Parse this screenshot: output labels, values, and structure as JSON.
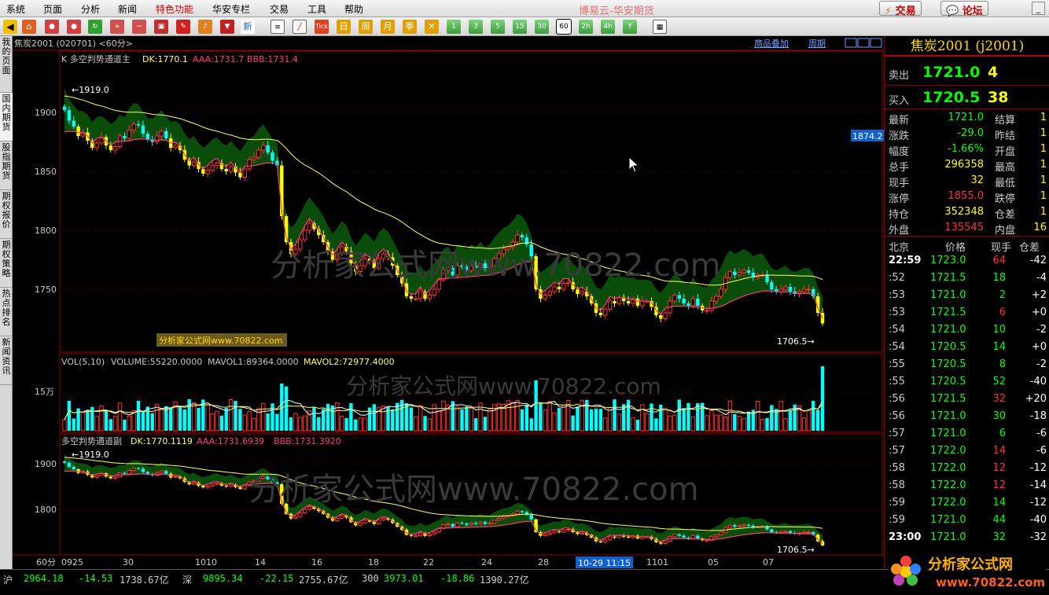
{
  "menu": {
    "items": [
      "系统",
      "页面",
      "分析",
      "新闻",
      "特色功能",
      "华安专栏",
      "交易",
      "工具",
      "帮助"
    ],
    "title": "博易云-华安期货",
    "trade_button": "交易",
    "forum_button": "论坛"
  },
  "toolbar": {
    "periods": [
      "1",
      "3",
      "5",
      "15",
      "30",
      "60",
      "2h",
      "4h",
      "Y"
    ],
    "selected_period": "60",
    "tick_label": "Tick",
    "day": "日",
    "week": "周",
    "month": "月",
    "season": "季",
    "new_label": "新"
  },
  "left_tabs": [
    "我的页面",
    "国内期货",
    "股指期货",
    "期权报价",
    "期权策略",
    "热点排名",
    "新闻资讯"
  ],
  "chart": {
    "symbol_header": "焦炭2001 (020701) <60分>",
    "links": [
      "商品叠加",
      "周期"
    ],
    "main_indicator": {
      "name": "K  多空判势通道主",
      "dk": "DK:1770.1",
      "aaa": "AAA:1731.7",
      "bbb": "BBB:1731.4",
      "y_ticks": [
        "1900",
        "1850",
        "1800",
        "1750"
      ],
      "high_label": "1919.0",
      "low_label": "1706.5",
      "cursor_price": "1874.2"
    },
    "volume_indicator": {
      "name": "VOL(5,10)",
      "volume": "VOLUME:55220.0000",
      "mavol1": "MAVOL1:89364.0000",
      "mavol2": "MAVOL2:72977.4000",
      "y_tick": "15万"
    },
    "sub_indicator": {
      "name": "多空判势通道副",
      "dk": "DK:1770.1119",
      "aaa": "AAA:1731.6939",
      "bbb": "BBB:1731.3920",
      "y_ticks": [
        "1900",
        "1800"
      ],
      "high_label": "1919.0",
      "low_label": "1706.5"
    },
    "x_axis": {
      "period_label": "60分",
      "ticks": [
        "0925",
        "30",
        "1010",
        "14",
        "16",
        "18",
        "22",
        "24",
        "28",
        "1101",
        "05",
        "07"
      ],
      "cursor_time": "10-29 11:15"
    },
    "watermark": "分析家公式网www.70822.com",
    "watermark_box": "分析家公式网www.70822.com",
    "colors": {
      "up": "#ff3232",
      "down": "#00ffff",
      "dk_line": "#ffff66",
      "aaa_line": "#ff3c78",
      "channel": "#0c5a0c"
    }
  },
  "chart_data": {
    "type": "candlestick",
    "title": "焦炭2001 (020701) <60分>",
    "ylim": [
      1706.5,
      1919.0
    ],
    "closes": [
      1902,
      1893,
      1888,
      1880,
      1883,
      1876,
      1870,
      1874,
      1879,
      1872,
      1868,
      1871,
      1880,
      1878,
      1885,
      1890,
      1889,
      1882,
      1877,
      1875,
      1880,
      1884,
      1878,
      1870,
      1872,
      1868,
      1860,
      1855,
      1858,
      1852,
      1848,
      1851,
      1855,
      1857,
      1852,
      1850,
      1854,
      1849,
      1845,
      1852,
      1860,
      1862,
      1868,
      1872,
      1866,
      1859,
      1855,
      1812,
      1790,
      1780,
      1784,
      1792,
      1800,
      1806,
      1801,
      1796,
      1790,
      1782,
      1775,
      1780,
      1786,
      1782,
      1772,
      1765,
      1770,
      1776,
      1773,
      1768,
      1776,
      1780,
      1777,
      1770,
      1762,
      1755,
      1744,
      1742,
      1742,
      1748,
      1742,
      1745,
      1750,
      1758,
      1766,
      1768,
      1762,
      1770,
      1769,
      1766,
      1770,
      1768,
      1772,
      1768,
      1770,
      1776,
      1780,
      1784,
      1786,
      1790,
      1796,
      1794,
      1788,
      1778,
      1750,
      1742,
      1745,
      1748,
      1752,
      1750,
      1755,
      1756,
      1750,
      1746,
      1748,
      1744,
      1738,
      1730,
      1728,
      1733,
      1740,
      1738,
      1743,
      1740,
      1738,
      1742,
      1736,
      1740,
      1740,
      1735,
      1728,
      1725,
      1730,
      1740,
      1745,
      1742,
      1738,
      1736,
      1742,
      1736,
      1732,
      1732,
      1740,
      1744,
      1750,
      1760,
      1765,
      1762,
      1764,
      1766,
      1764,
      1760,
      1762,
      1762,
      1756,
      1750,
      1748,
      1750,
      1752,
      1748,
      1746,
      1748,
      1750,
      1750,
      1744,
      1730,
      1721
    ],
    "vol_ticks": [
      "15万"
    ],
    "dk": 1770.1,
    "aaa": 1731.7,
    "bbb": 1731.4,
    "volume": 55220,
    "mavol1": 89364,
    "mavol2": 72977.4
  },
  "quote": {
    "title": "焦炭2001 (j2001)",
    "sell_label": "卖出",
    "sell_price": "1721.0",
    "sell_vol": "4",
    "buy_label": "买入",
    "buy_price": "1720.5",
    "buy_vol": "38",
    "rows": [
      {
        "l1": "最新",
        "v1": "1721.0",
        "l2": "结算",
        "v2": "1",
        "c1": "#00ff00"
      },
      {
        "l1": "涨跌",
        "v1": "-29.0",
        "l2": "昨结",
        "v2": "1",
        "c1": "#00ff00"
      },
      {
        "l1": "幅度",
        "v1": "-1.66%",
        "l2": "开盘",
        "v2": "1",
        "c1": "#00ff00"
      },
      {
        "l1": "总手",
        "v1": "296358",
        "l2": "最高",
        "v2": "1",
        "c1": "#ffff00"
      },
      {
        "l1": "现手",
        "v1": "32",
        "l2": "最低",
        "v2": "1",
        "c1": "#ffff00"
      },
      {
        "l1": "涨停",
        "v1": "1855.0",
        "l2": "跌停",
        "v2": "1",
        "c1": "#ff3232"
      },
      {
        "l1": "持仓",
        "v1": "352348",
        "l2": "仓差",
        "v2": "1",
        "c1": "#ffff00"
      },
      {
        "l1": "外盘",
        "v1": "135545",
        "l2": "内盘",
        "v2": "16",
        "c1": "#ff3232"
      }
    ],
    "tick_header": {
      "time": "北京",
      "price": "价格",
      "vol": "现手",
      "oi": "仓差"
    },
    "ticks": [
      {
        "t": "22:59",
        "p": "1723.0",
        "v": "64",
        "o": "-42",
        "vc": "#ff3232"
      },
      {
        "t": ":52",
        "p": "1721.5",
        "v": "18",
        "o": "-4",
        "vc": "#00ff00"
      },
      {
        "t": ":53",
        "p": "1721.0",
        "v": "2",
        "o": "+2",
        "vc": "#00ff00"
      },
      {
        "t": ":53",
        "p": "1721.5",
        "v": "6",
        "o": "+0",
        "vc": "#ff3232"
      },
      {
        "t": ":54",
        "p": "1721.0",
        "v": "10",
        "o": "-2",
        "vc": "#00ff00"
      },
      {
        "t": ":54",
        "p": "1720.5",
        "v": "14",
        "o": "+0",
        "vc": "#00ff00"
      },
      {
        "t": ":55",
        "p": "1720.5",
        "v": "8",
        "o": "-2",
        "vc": "#00ff00"
      },
      {
        "t": ":55",
        "p": "1720.5",
        "v": "52",
        "o": "-40",
        "vc": "#00ff00"
      },
      {
        "t": ":56",
        "p": "1721.5",
        "v": "32",
        "o": "+20",
        "vc": "#ff3232"
      },
      {
        "t": ":56",
        "p": "1721.0",
        "v": "30",
        "o": "-18",
        "vc": "#00ff00"
      },
      {
        "t": ":57",
        "p": "1721.0",
        "v": "6",
        "o": "-6",
        "vc": "#00ff00"
      },
      {
        "t": ":57",
        "p": "1722.0",
        "v": "14",
        "o": "-6",
        "vc": "#ff3232"
      },
      {
        "t": ":58",
        "p": "1722.0",
        "v": "12",
        "o": "-12",
        "vc": "#ff3232"
      },
      {
        "t": ":58",
        "p": "1722.0",
        "v": "12",
        "o": "-14",
        "vc": "#ff3232"
      },
      {
        "t": ":59",
        "p": "1722.0",
        "v": "14",
        "o": "-12",
        "vc": "#00ff00"
      },
      {
        "t": ":59",
        "p": "1721.0",
        "v": "44",
        "o": "-40",
        "vc": "#00ff00"
      },
      {
        "t": "23:00",
        "p": "1721.0",
        "v": "32",
        "o": "-32",
        "vc": "#00ff00"
      }
    ]
  },
  "status": {
    "sh_label": "沪",
    "sh_index": "2964.18",
    "sh_change": "-14.53",
    "sh_amount": "1738.67亿",
    "sz_label": "深",
    "sz_index": "9895.34",
    "sz_change": "-22.15",
    "sz_amount": "2755.67亿",
    "c300_label": "300",
    "c300_index": "3973.01",
    "c300_change": "-18.86",
    "c300_amount": "1390.27亿"
  },
  "logo": {
    "text": "分析家公式网",
    "url": "www.70822.com"
  }
}
